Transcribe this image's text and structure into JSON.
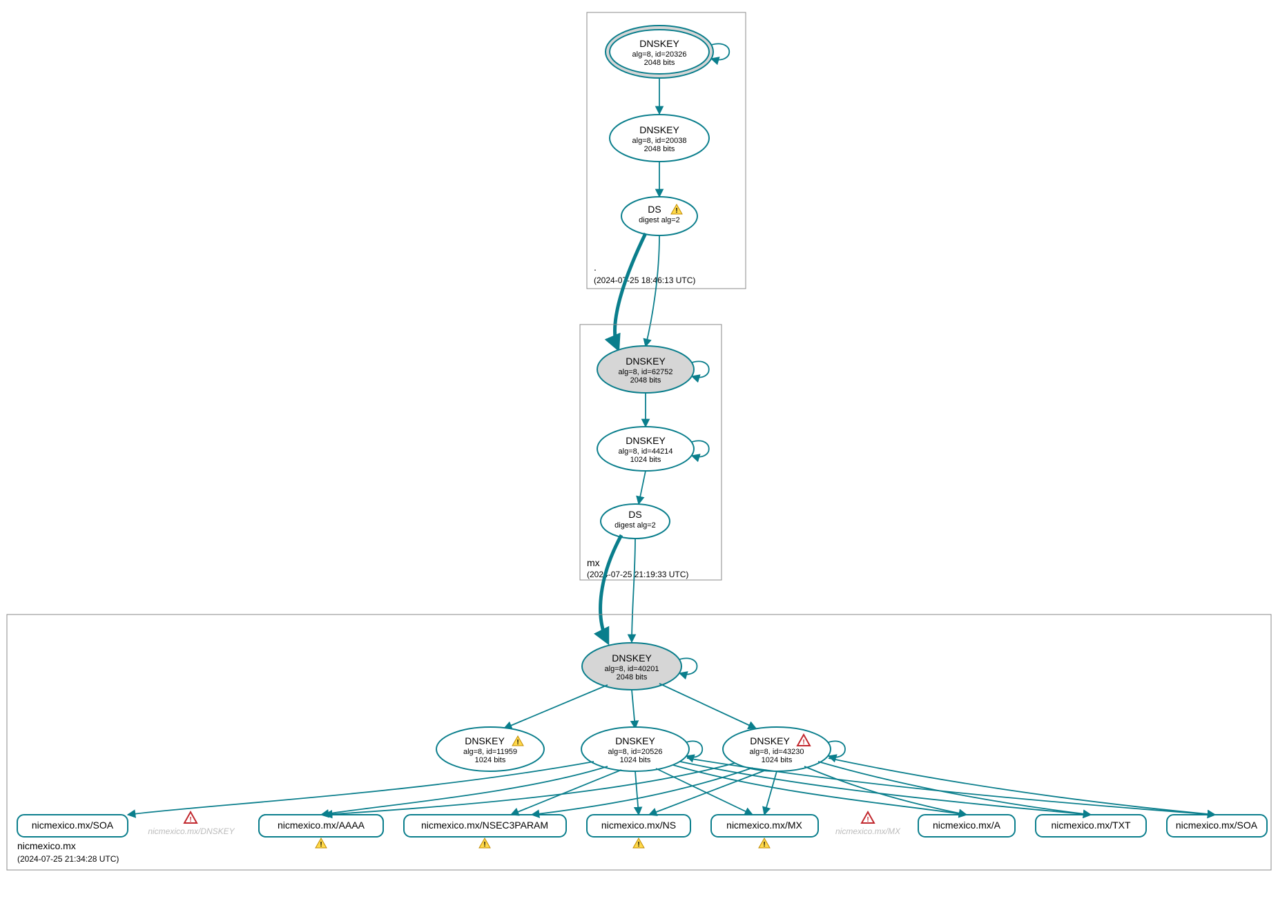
{
  "zones": {
    "root": {
      "label": ".",
      "timestamp": "(2024-07-25 18:46:13 UTC)"
    },
    "mx": {
      "label": "mx",
      "timestamp": "(2024-07-25 21:19:33 UTC)"
    },
    "nicmexico": {
      "label": "nicmexico.mx",
      "timestamp": "(2024-07-25 21:34:28 UTC)"
    }
  },
  "nodes": {
    "root_ksk": {
      "title": "DNSKEY",
      "line1": "alg=8, id=20326",
      "line2": "2048 bits"
    },
    "root_zsk": {
      "title": "DNSKEY",
      "line1": "alg=8, id=20038",
      "line2": "2048 bits"
    },
    "root_ds": {
      "title": "DS",
      "line1": "digest alg=2"
    },
    "mx_ksk": {
      "title": "DNSKEY",
      "line1": "alg=8, id=62752",
      "line2": "2048 bits"
    },
    "mx_zsk": {
      "title": "DNSKEY",
      "line1": "alg=8, id=44214",
      "line2": "1024 bits"
    },
    "mx_ds": {
      "title": "DS",
      "line1": "digest alg=2"
    },
    "nic_ksk": {
      "title": "DNSKEY",
      "line1": "alg=8, id=40201",
      "line2": "2048 bits"
    },
    "nic_zsk1": {
      "title": "DNSKEY",
      "line1": "alg=8, id=11959",
      "line2": "1024 bits"
    },
    "nic_zsk2": {
      "title": "DNSKEY",
      "line1": "alg=8, id=20526",
      "line2": "1024 bits"
    },
    "nic_zsk3": {
      "title": "DNSKEY",
      "line1": "alg=8, id=43230",
      "line2": "1024 bits"
    }
  },
  "rrsets": {
    "r1": "nicmexico.mx/SOA",
    "r2": "nicmexico.mx/AAAA",
    "r3": "nicmexico.mx/NSEC3PARAM",
    "r4": "nicmexico.mx/NS",
    "r5": "nicmexico.mx/MX",
    "r6": "nicmexico.mx/A",
    "r7": "nicmexico.mx/TXT",
    "r8": "nicmexico.mx/SOA"
  },
  "ghosts": {
    "g1": "nicmexico.mx/DNSKEY",
    "g2": "nicmexico.mx/MX"
  }
}
